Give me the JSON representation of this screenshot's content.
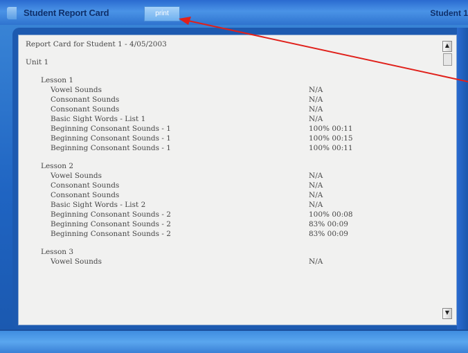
{
  "window": {
    "title": "Student Report Card",
    "print_label": "print",
    "student_label": "Student 1"
  },
  "report": {
    "header": "Report Card for Student 1 - 4/05/2003",
    "unit": "Unit 1",
    "lessons": [
      {
        "title": "Lesson 1",
        "items": [
          {
            "name": "Vowel Sounds",
            "value": "N/A"
          },
          {
            "name": "Consonant Sounds",
            "value": "N/A"
          },
          {
            "name": "Consonant Sounds",
            "value": "N/A"
          },
          {
            "name": "Basic Sight Words - List 1",
            "value": "N/A"
          },
          {
            "name": "Beginning Consonant Sounds - 1",
            "value": "100% 00:11"
          },
          {
            "name": "Beginning Consonant Sounds - 1",
            "value": "100% 00:15"
          },
          {
            "name": "Beginning Consonant Sounds - 1",
            "value": "100% 00:11"
          }
        ]
      },
      {
        "title": "Lesson 2",
        "items": [
          {
            "name": "Vowel Sounds",
            "value": "N/A"
          },
          {
            "name": "Consonant Sounds",
            "value": "N/A"
          },
          {
            "name": "Consonant Sounds",
            "value": "N/A"
          },
          {
            "name": "Basic Sight Words - List 2",
            "value": "N/A"
          },
          {
            "name": "Beginning Consonant Sounds - 2",
            "value": "100% 00:08"
          },
          {
            "name": "Beginning Consonant Sounds - 2",
            "value": "83% 00:09"
          },
          {
            "name": "Beginning Consonant Sounds - 2",
            "value": "83% 00:09"
          }
        ]
      },
      {
        "title": "Lesson 3",
        "items": [
          {
            "name": "Vowel Sounds",
            "value": "N/A"
          }
        ]
      }
    ]
  },
  "colors": {
    "frame_blue": "#1f64c2",
    "paper": "#f1f1f0",
    "annotation_arrow": "#e0201a"
  }
}
